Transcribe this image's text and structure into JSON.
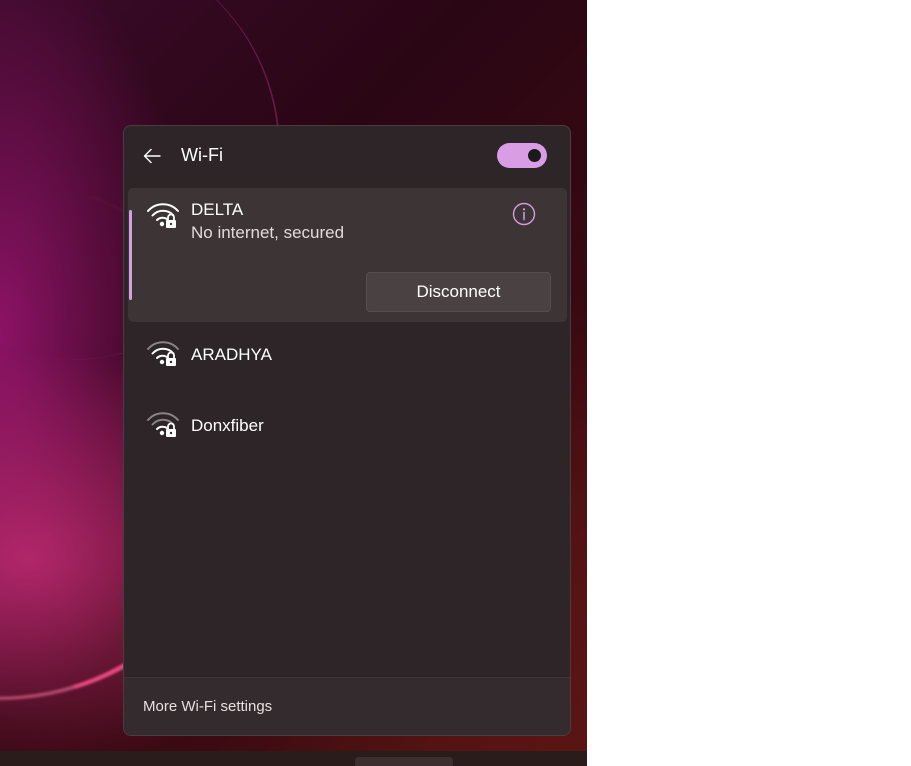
{
  "panel": {
    "title": "Wi-Fi",
    "toggle_state": "on",
    "accent_color": "#d99de6"
  },
  "networks": [
    {
      "name": "DELTA",
      "status": "No internet, secured",
      "connected": true,
      "icon": "wifi-secured-icon",
      "action_label": "Disconnect"
    },
    {
      "name": "ARADHYA",
      "icon": "wifi-secured-icon"
    },
    {
      "name": "Donxfiber",
      "icon": "wifi-secured-icon"
    }
  ],
  "footer": {
    "settings_label": "More Wi-Fi settings"
  }
}
